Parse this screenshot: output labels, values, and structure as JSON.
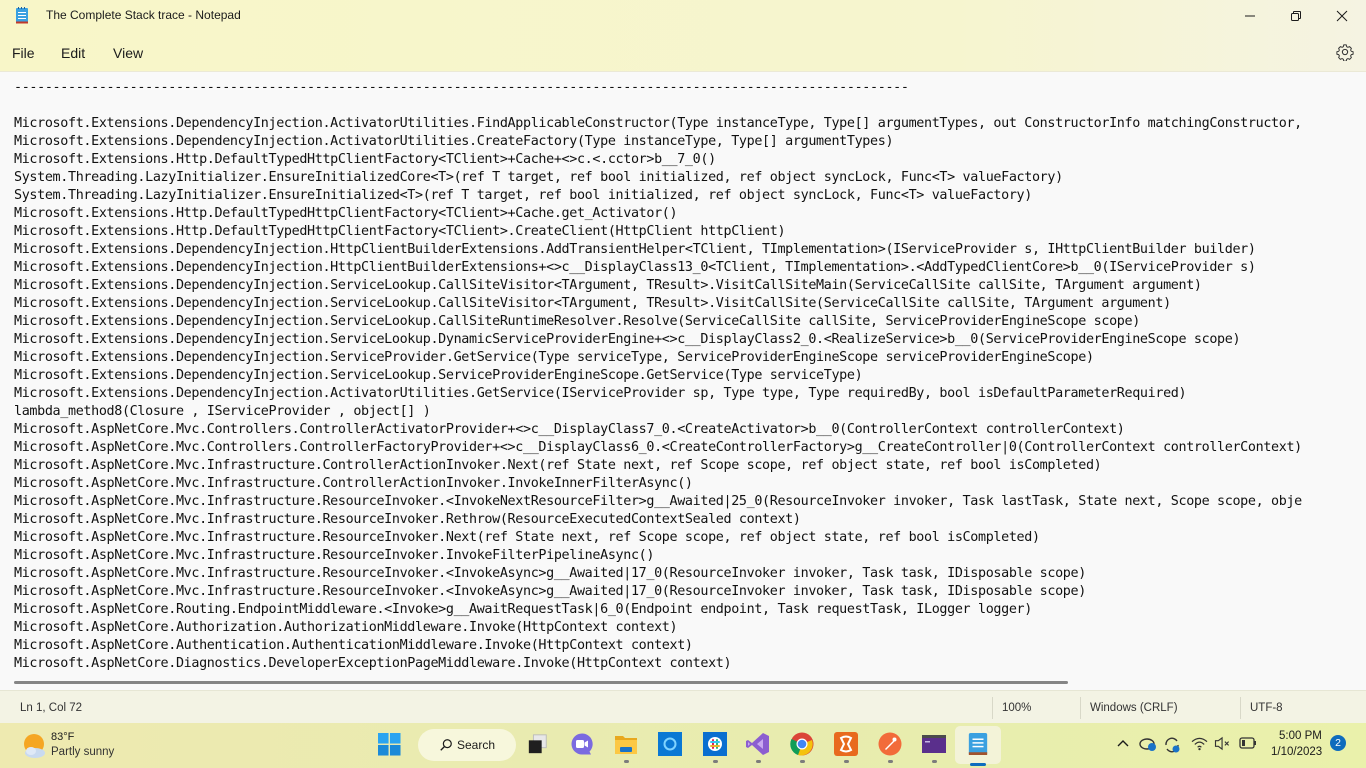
{
  "window": {
    "title": "The Complete Stack trace - Notepad",
    "app_icon": "notepad-icon",
    "controls": {
      "minimize": "minimize-icon",
      "maximize": "restore-icon",
      "close": "close-icon"
    }
  },
  "menu": {
    "items": [
      {
        "label": "File"
      },
      {
        "label": "Edit"
      },
      {
        "label": "View"
      }
    ],
    "settings_icon": "gear-icon"
  },
  "editor": {
    "lines": [
      "--------------------------------------------------------------------------------------------------------------------",
      "",
      "Microsoft.Extensions.DependencyInjection.ActivatorUtilities.FindApplicableConstructor(Type instanceType, Type[] argumentTypes, out ConstructorInfo matchingConstructor,",
      "Microsoft.Extensions.DependencyInjection.ActivatorUtilities.CreateFactory(Type instanceType, Type[] argumentTypes)",
      "Microsoft.Extensions.Http.DefaultTypedHttpClientFactory<TClient>+Cache+<>c.<.cctor>b__7_0()",
      "System.Threading.LazyInitializer.EnsureInitializedCore<T>(ref T target, ref bool initialized, ref object syncLock, Func<T> valueFactory)",
      "System.Threading.LazyInitializer.EnsureInitialized<T>(ref T target, ref bool initialized, ref object syncLock, Func<T> valueFactory)",
      "Microsoft.Extensions.Http.DefaultTypedHttpClientFactory<TClient>+Cache.get_Activator()",
      "Microsoft.Extensions.Http.DefaultTypedHttpClientFactory<TClient>.CreateClient(HttpClient httpClient)",
      "Microsoft.Extensions.DependencyInjection.HttpClientBuilderExtensions.AddTransientHelper<TClient, TImplementation>(IServiceProvider s, IHttpClientBuilder builder)",
      "Microsoft.Extensions.DependencyInjection.HttpClientBuilderExtensions+<>c__DisplayClass13_0<TClient, TImplementation>.<AddTypedClientCore>b__0(IServiceProvider s)",
      "Microsoft.Extensions.DependencyInjection.ServiceLookup.CallSiteVisitor<TArgument, TResult>.VisitCallSiteMain(ServiceCallSite callSite, TArgument argument)",
      "Microsoft.Extensions.DependencyInjection.ServiceLookup.CallSiteVisitor<TArgument, TResult>.VisitCallSite(ServiceCallSite callSite, TArgument argument)",
      "Microsoft.Extensions.DependencyInjection.ServiceLookup.CallSiteRuntimeResolver.Resolve(ServiceCallSite callSite, ServiceProviderEngineScope scope)",
      "Microsoft.Extensions.DependencyInjection.ServiceLookup.DynamicServiceProviderEngine+<>c__DisplayClass2_0.<RealizeService>b__0(ServiceProviderEngineScope scope)",
      "Microsoft.Extensions.DependencyInjection.ServiceProvider.GetService(Type serviceType, ServiceProviderEngineScope serviceProviderEngineScope)",
      "Microsoft.Extensions.DependencyInjection.ServiceLookup.ServiceProviderEngineScope.GetService(Type serviceType)",
      "Microsoft.Extensions.DependencyInjection.ActivatorUtilities.GetService(IServiceProvider sp, Type type, Type requiredBy, bool isDefaultParameterRequired)",
      "lambda_method8(Closure , IServiceProvider , object[] )",
      "Microsoft.AspNetCore.Mvc.Controllers.ControllerActivatorProvider+<>c__DisplayClass7_0.<CreateActivator>b__0(ControllerContext controllerContext)",
      "Microsoft.AspNetCore.Mvc.Controllers.ControllerFactoryProvider+<>c__DisplayClass6_0.<CreateControllerFactory>g__CreateController|0(ControllerContext controllerContext)",
      "Microsoft.AspNetCore.Mvc.Infrastructure.ControllerActionInvoker.Next(ref State next, ref Scope scope, ref object state, ref bool isCompleted)",
      "Microsoft.AspNetCore.Mvc.Infrastructure.ControllerActionInvoker.InvokeInnerFilterAsync()",
      "Microsoft.AspNetCore.Mvc.Infrastructure.ResourceInvoker.<InvokeNextResourceFilter>g__Awaited|25_0(ResourceInvoker invoker, Task lastTask, State next, Scope scope, obje",
      "Microsoft.AspNetCore.Mvc.Infrastructure.ResourceInvoker.Rethrow(ResourceExecutedContextSealed context)",
      "Microsoft.AspNetCore.Mvc.Infrastructure.ResourceInvoker.Next(ref State next, ref Scope scope, ref object state, ref bool isCompleted)",
      "Microsoft.AspNetCore.Mvc.Infrastructure.ResourceInvoker.InvokeFilterPipelineAsync()",
      "Microsoft.AspNetCore.Mvc.Infrastructure.ResourceInvoker.<InvokeAsync>g__Awaited|17_0(ResourceInvoker invoker, Task task, IDisposable scope)",
      "Microsoft.AspNetCore.Mvc.Infrastructure.ResourceInvoker.<InvokeAsync>g__Awaited|17_0(ResourceInvoker invoker, Task task, IDisposable scope)",
      "Microsoft.AspNetCore.Routing.EndpointMiddleware.<Invoke>g__AwaitRequestTask|6_0(Endpoint endpoint, Task requestTask, ILogger logger)",
      "Microsoft.AspNetCore.Authorization.AuthorizationMiddleware.Invoke(HttpContext context)",
      "Microsoft.AspNetCore.Authentication.AuthenticationMiddleware.Invoke(HttpContext context)",
      "Microsoft.AspNetCore.Diagnostics.DeveloperExceptionPageMiddleware.Invoke(HttpContext context)"
    ]
  },
  "statusbar": {
    "position": "Ln 1, Col 72",
    "zoom": "100%",
    "line_ending": "Windows (CRLF)",
    "encoding": "UTF-8"
  },
  "taskbar": {
    "weather": {
      "temperature": "83°F",
      "condition": "Partly sunny",
      "icon": "partly-sunny-icon"
    },
    "search_label": "Search",
    "apps": [
      {
        "name": "start",
        "icon": "windows-start-icon"
      },
      {
        "name": "task-view",
        "icon": "task-view-icon"
      },
      {
        "name": "teams-chat",
        "icon": "teams-chat-icon"
      },
      {
        "name": "file-explorer",
        "icon": "folder-icon"
      },
      {
        "name": "cortana",
        "icon": "cortana-icon"
      },
      {
        "name": "slack",
        "icon": "slack-icon"
      },
      {
        "name": "visual-studio",
        "icon": "visual-studio-icon"
      },
      {
        "name": "chrome",
        "icon": "chrome-icon"
      },
      {
        "name": "xampp",
        "icon": "xampp-icon"
      },
      {
        "name": "postman",
        "icon": "postman-icon"
      },
      {
        "name": "terminal",
        "icon": "terminal-icon"
      },
      {
        "name": "notepad",
        "icon": "notepad-icon",
        "active": true
      }
    ],
    "tray": {
      "icons": [
        "chevron-up-icon",
        "onedrive-sync-icon",
        "sync-icon",
        "wifi-icon",
        "volume-muted-icon",
        "battery-icon"
      ],
      "time": "5:00 PM",
      "date": "1/10/2023",
      "notification_count": "2"
    }
  }
}
